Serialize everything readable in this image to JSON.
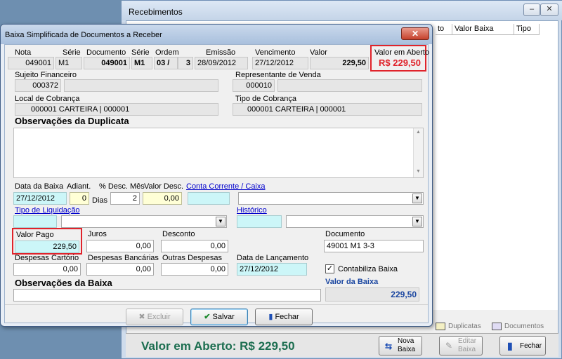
{
  "bg_window": {
    "title": "Recebimentos",
    "min_label": "–",
    "close_label": "✕",
    "grid_headers": [
      "Valor Baixa",
      "Tipo"
    ],
    "grid_partial_header": "to",
    "legend": [
      "Duplicatas",
      "Documentos"
    ],
    "open_value_text": "Valor em Aberto: R$ 229,50",
    "buttons": {
      "nova_baixa": "Nova Baixa",
      "editar_baixa": "Editar Baixa",
      "fechar": "Fechar"
    }
  },
  "dialog": {
    "title": "Baixa Simplificada de Documentos a Receber",
    "close_label": "✕",
    "header": {
      "labels": {
        "nota": "Nota",
        "serie": "Série",
        "documento": "Documento",
        "serie2": "Série",
        "ordem": "Ordem",
        "emissao": "Emissão",
        "vencimento": "Vencimento",
        "valor": "Valor",
        "valor_aberto": "Valor em Aberto"
      },
      "values": {
        "nota": "049001",
        "serie": "M1",
        "documento": "049001",
        "serie2": "M1",
        "ordem": "03 /",
        "ordem_total": "3",
        "emissao": "28/09/2012",
        "vencimento": "27/12/2012",
        "valor": "229,50",
        "valor_aberto": "R$ 229,50"
      }
    },
    "sujeito": {
      "label": "Sujeito Financeiro",
      "code": "000372",
      "name": ""
    },
    "representante": {
      "label": "Representante de Venda",
      "code": "000010",
      "name": ""
    },
    "local_cobranca": {
      "label": "Local de Cobrança",
      "value": "000001   CARTEIRA            | 000001"
    },
    "tipo_cobranca": {
      "label": "Tipo de Cobrança",
      "value": "000001   CARTEIRA            | 000001"
    },
    "obs_duplicata_title": "Observações da Duplicata",
    "baixa": {
      "data_label": "Data da Baixa",
      "data_value": "27/12/2012",
      "adiant_label": "Adiant.",
      "adiant_value": "0",
      "desc_mes_label": "% Desc. Mês",
      "dias_label": "Dias",
      "dias_value": "2",
      "valor_desc_label": "Valor Desc.",
      "valor_desc_value": "0,00",
      "conta_link": "Conta Corrente / Caixa",
      "tipo_liq_link": "Tipo de Liquidação",
      "historico_link": "Histórico"
    },
    "valores": {
      "valor_pago_label": "Valor Pago",
      "valor_pago": "229,50",
      "juros_label": "Juros",
      "juros": "0,00",
      "desconto_label": "Desconto",
      "desconto": "0,00",
      "documento_label": "Documento",
      "documento": "49001 M1  3-3",
      "desp_cartorio_label": "Despesas Cartório",
      "desp_cartorio": "0,00",
      "desp_bancarias_label": "Despesas Bancárias",
      "desp_bancarias": "0,00",
      "outras_label": "Outras Despesas",
      "outras": "0,00",
      "lancamento_label": "Data de Lançamento",
      "lancamento": "27/12/2012",
      "contabiliza_label": "Contabiliza Baixa",
      "contabiliza_checked": true,
      "valor_baixa_label": "Valor da Baixa",
      "valor_baixa": "229,50"
    },
    "obs_baixa_title": "Observações da Baixa",
    "buttons": {
      "excluir": "Excluir",
      "salvar": "Salvar",
      "fechar": "Fechar"
    }
  },
  "colors": {
    "highlight_border": "#e0232b",
    "open_value_text": "#1c6e50",
    "link": "#0000cc",
    "cyan_field": "#ccf6f8",
    "yellow_field": "#ffffd6"
  }
}
